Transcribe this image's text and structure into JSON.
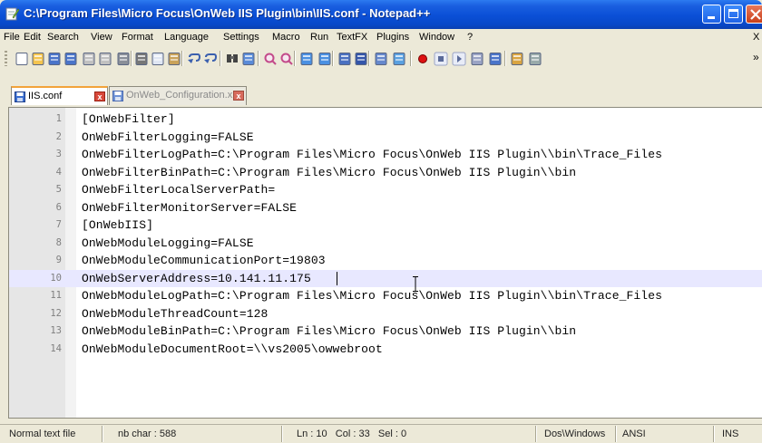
{
  "window": {
    "title": "C:\\Program Files\\Micro Focus\\OnWeb IIS Plugin\\bin\\IIS.conf - Notepad++"
  },
  "menu": [
    {
      "label": "File"
    },
    {
      "label": "Edit"
    },
    {
      "label": "Search"
    },
    {
      "label": "View"
    },
    {
      "label": "Format"
    },
    {
      "label": "Language"
    },
    {
      "label": "Settings"
    },
    {
      "label": "Macro"
    },
    {
      "label": "Run"
    },
    {
      "label": "TextFX"
    },
    {
      "label": "Plugins"
    },
    {
      "label": "Window"
    },
    {
      "label": "?"
    }
  ],
  "menu_close": "X",
  "toolbar_overflow": "»",
  "toolbar_icons": [
    "new-file-icon",
    "open-file-icon",
    "save-icon",
    "save-all-icon",
    "close-icon",
    "close-all-icon",
    "print-icon",
    "cut-icon",
    "copy-icon",
    "paste-icon",
    "undo-icon",
    "redo-icon",
    "find-icon",
    "replace-icon",
    "zoom-in-icon",
    "zoom-out-icon",
    "sync-vertical-icon",
    "sync-horizontal-icon",
    "word-wrap-icon",
    "show-all-chars-icon",
    "indent-guide-icon",
    "user-defined-dialog-icon",
    "record-macro-icon",
    "stop-record-icon",
    "play-macro-icon",
    "run-macro-multiple-icon",
    "save-macro-icon",
    "spell-check-icon",
    "console-icon"
  ],
  "tabs": [
    {
      "label": "IIS.conf",
      "active": true
    },
    {
      "label": "OnWeb_Configuration.xml",
      "active": false
    }
  ],
  "tab_close_glyph": "x",
  "editor": {
    "current_line": 10,
    "lines": [
      {
        "num": "1",
        "text": "[OnWebFilter]"
      },
      {
        "num": "2",
        "text": "OnWebFilterLogging=FALSE"
      },
      {
        "num": "3",
        "text": "OnWebFilterLogPath=C:\\Program Files\\Micro Focus\\OnWeb IIS Plugin\\\\bin\\Trace_Files"
      },
      {
        "num": "4",
        "text": "OnWebFilterBinPath=C:\\Program Files\\Micro Focus\\OnWeb IIS Plugin\\\\bin"
      },
      {
        "num": "5",
        "text": "OnWebFilterLocalServerPath="
      },
      {
        "num": "6",
        "text": "OnWebFilterMonitorServer=FALSE"
      },
      {
        "num": "7",
        "text": "[OnWebIIS]"
      },
      {
        "num": "8",
        "text": "OnWebModuleLogging=FALSE"
      },
      {
        "num": "9",
        "text": "OnWebModuleCommunicationPort=19803"
      },
      {
        "num": "10",
        "text": "OnWebServerAddress=10.141.11.175"
      },
      {
        "num": "11",
        "text": "OnWebModuleLogPath=C:\\Program Files\\Micro Focus\\OnWeb IIS Plugin\\\\bin\\Trace_Files"
      },
      {
        "num": "12",
        "text": "OnWebModuleThreadCount=128"
      },
      {
        "num": "13",
        "text": "OnWebModuleBinPath=C:\\Program Files\\Micro Focus\\OnWeb IIS Plugin\\\\bin"
      },
      {
        "num": "14",
        "text": "OnWebModuleDocumentRoot=\\\\vs2005\\owwebroot"
      }
    ]
  },
  "status": {
    "file_type": "Normal text file",
    "nb_char": "nb char : 588",
    "position": "Ln : 10   Col : 33   Sel : 0",
    "eol": "Dos\\Windows",
    "encoding": "ANSI",
    "mode": "INS"
  }
}
